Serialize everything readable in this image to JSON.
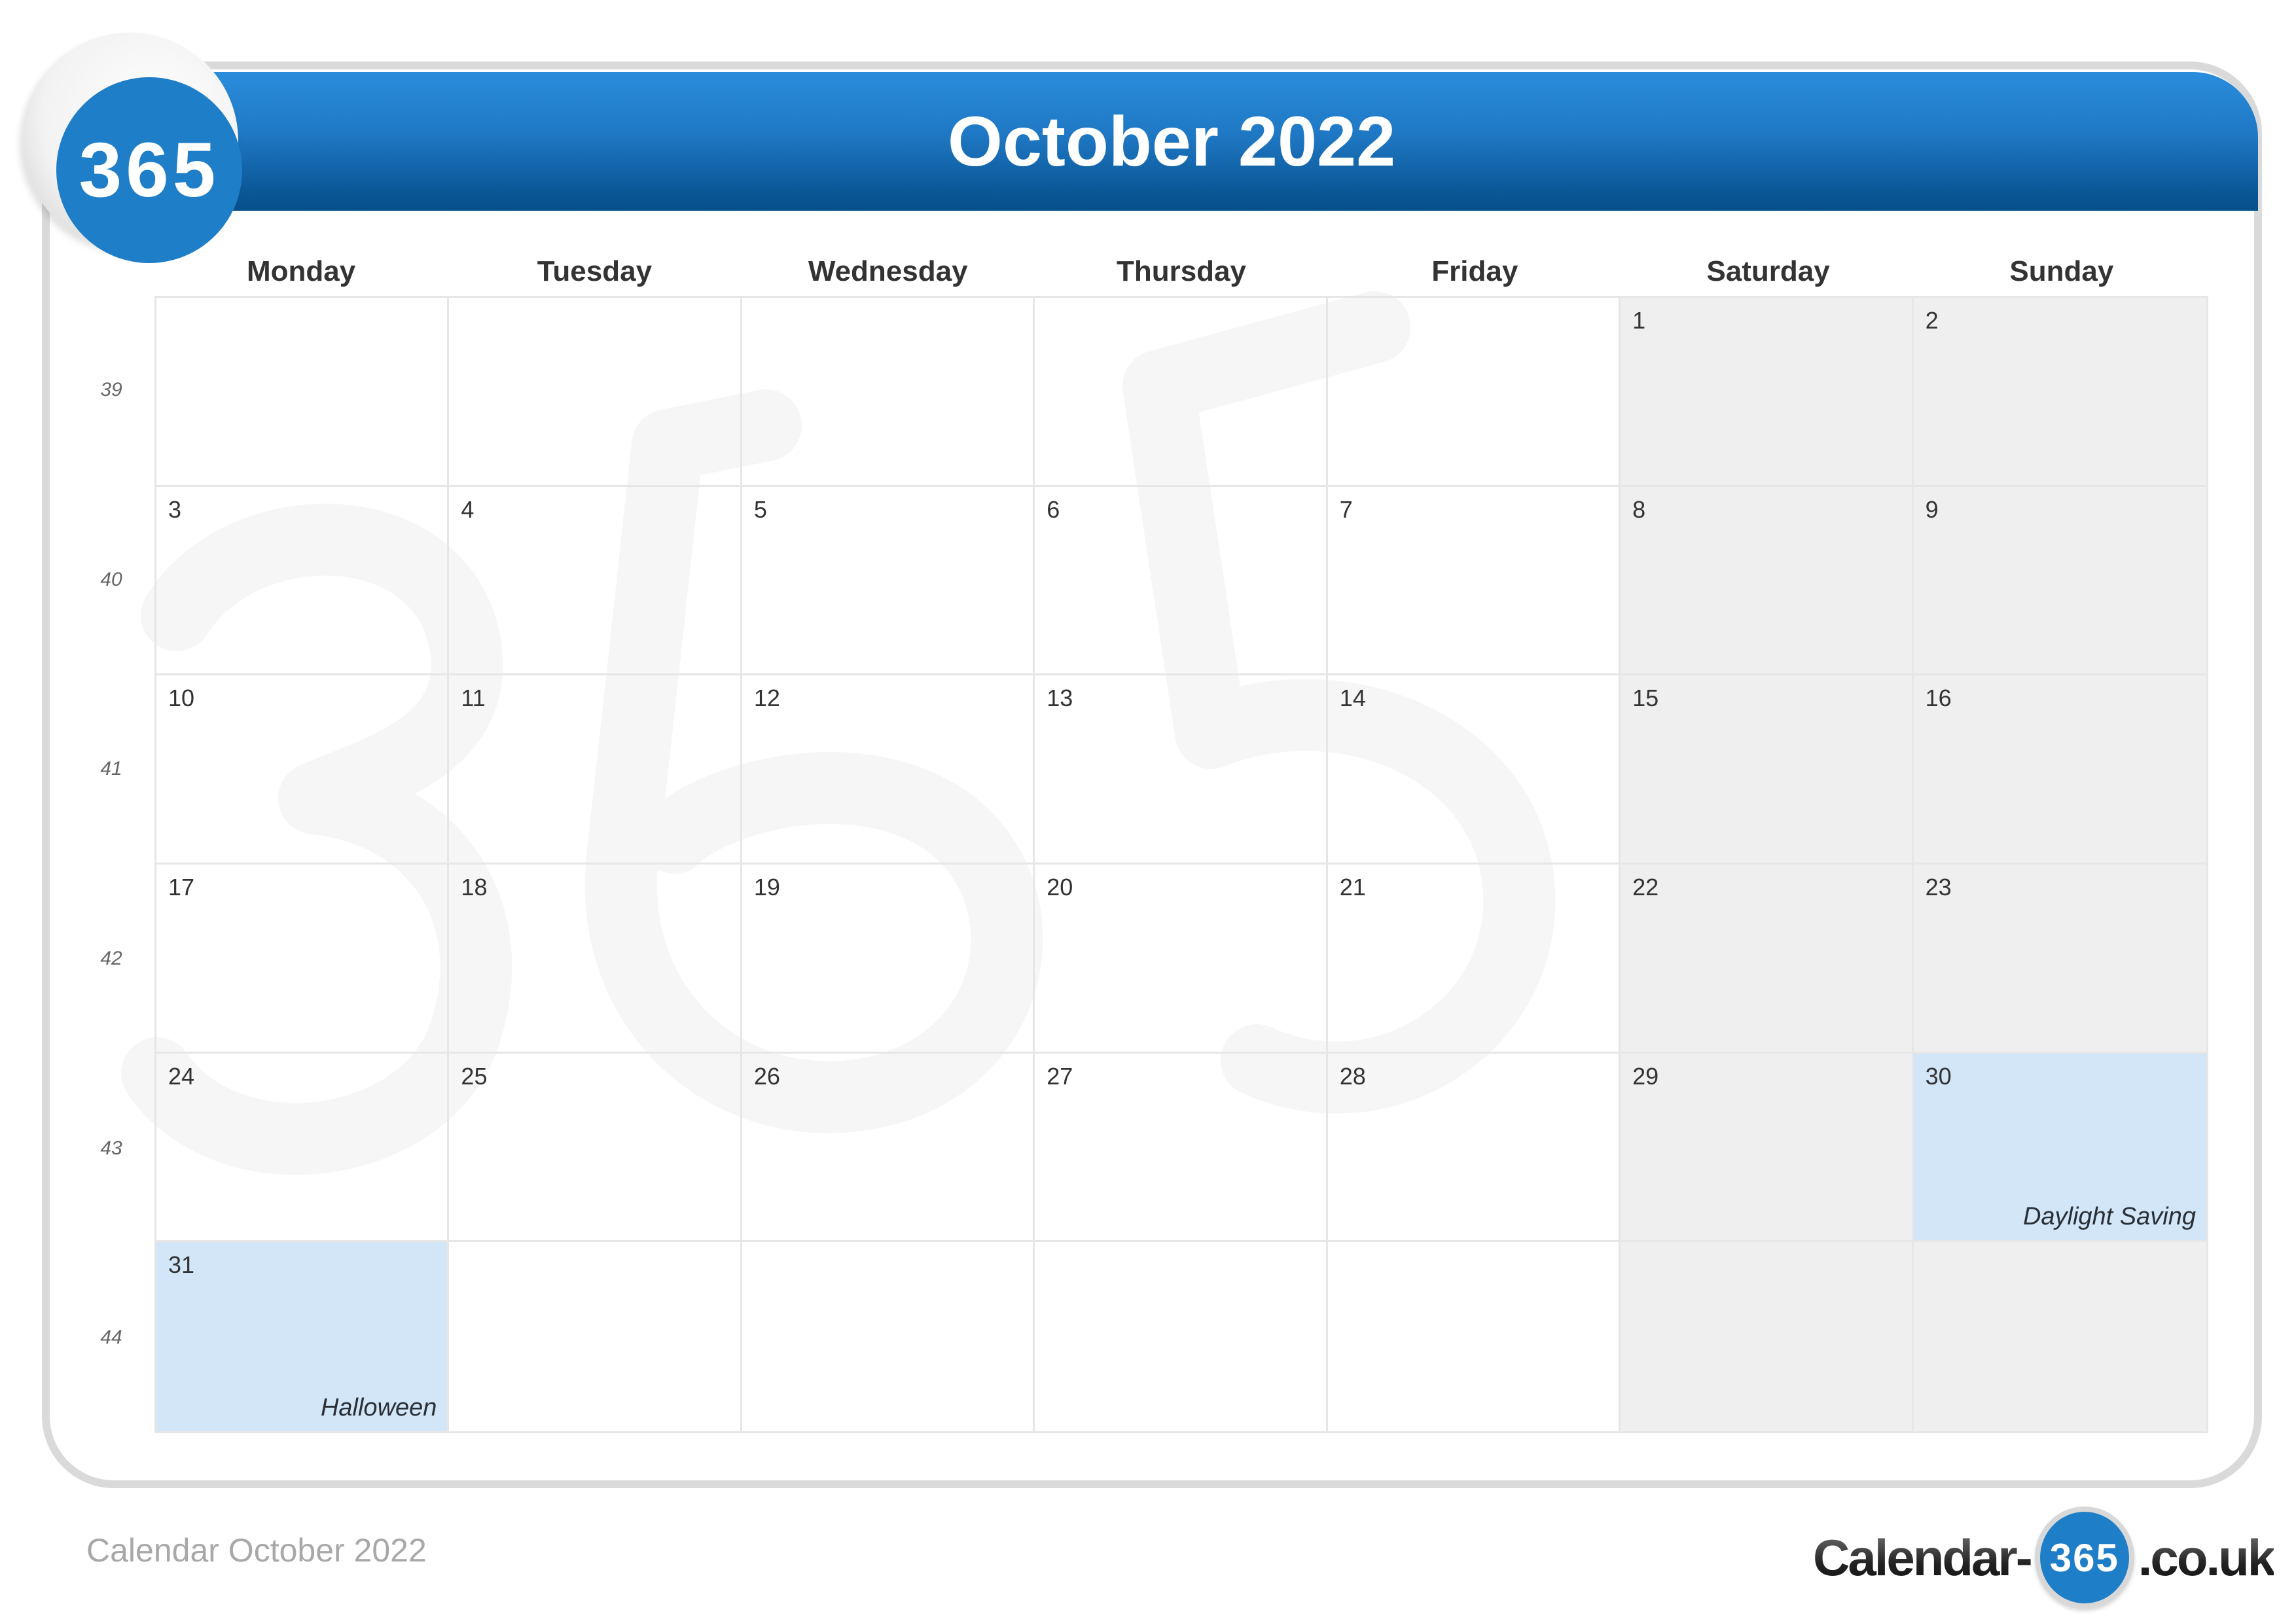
{
  "header": {
    "title": "October 2022",
    "logo_text": "365",
    "bar_color": "#1f78c4"
  },
  "weekdays": [
    "Monday",
    "Tuesday",
    "Wednesday",
    "Thursday",
    "Friday",
    "Saturday",
    "Sunday"
  ],
  "week_numbers": [
    "39",
    "40",
    "41",
    "42",
    "43",
    "44"
  ],
  "weeks": [
    [
      {
        "day": ""
      },
      {
        "day": ""
      },
      {
        "day": ""
      },
      {
        "day": ""
      },
      {
        "day": ""
      },
      {
        "day": "1"
      },
      {
        "day": "2"
      }
    ],
    [
      {
        "day": "3"
      },
      {
        "day": "4"
      },
      {
        "day": "5"
      },
      {
        "day": "6"
      },
      {
        "day": "7"
      },
      {
        "day": "8"
      },
      {
        "day": "9"
      }
    ],
    [
      {
        "day": "10"
      },
      {
        "day": "11"
      },
      {
        "day": "12"
      },
      {
        "day": "13"
      },
      {
        "day": "14"
      },
      {
        "day": "15"
      },
      {
        "day": "16"
      }
    ],
    [
      {
        "day": "17"
      },
      {
        "day": "18"
      },
      {
        "day": "19"
      },
      {
        "day": "20"
      },
      {
        "day": "21"
      },
      {
        "day": "22"
      },
      {
        "day": "23"
      }
    ],
    [
      {
        "day": "24"
      },
      {
        "day": "25"
      },
      {
        "day": "26"
      },
      {
        "day": "27"
      },
      {
        "day": "28"
      },
      {
        "day": "29"
      },
      {
        "day": "30",
        "event": "Daylight Saving",
        "highlight": true
      }
    ],
    [
      {
        "day": "31",
        "event": "Halloween",
        "highlight": true
      },
      {
        "day": ""
      },
      {
        "day": ""
      },
      {
        "day": ""
      },
      {
        "day": ""
      },
      {
        "day": ""
      },
      {
        "day": ""
      }
    ]
  ],
  "colors": {
    "weekend": "#efefef",
    "holiday": "#d2e6f8",
    "accent": "#1f7ec8"
  },
  "footer": {
    "caption": "Calendar October 2022",
    "brand_prefix": "Calendar-",
    "brand_badge": "365",
    "brand_suffix": ".co.uk"
  }
}
